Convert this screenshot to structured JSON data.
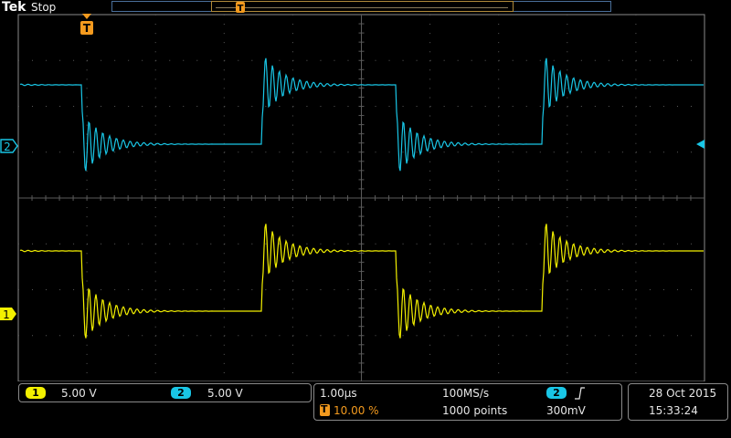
{
  "header": {
    "brand": "Tek",
    "run_state": "Stop"
  },
  "trigger": {
    "marker": "T",
    "position_percent": 10.0,
    "level_label": "10.00 %"
  },
  "channels": [
    {
      "id": "1",
      "color": "#f3f000",
      "scale": "5.00 V"
    },
    {
      "id": "2",
      "color": "#19c6e6",
      "scale": "5.00 V"
    }
  ],
  "timebase": {
    "scale": "1.00µs",
    "sample_rate": "100MS/s",
    "record_length": "1000 points",
    "trigger_source": "2",
    "trigger_slope_icon": "rising-edge-icon",
    "trigger_level": "300mV"
  },
  "datetime": {
    "date": "28 Oct  2015",
    "time": "15:33:24"
  },
  "colors": {
    "grid": "#5a5a5a",
    "trigger": "#f39a1e",
    "frame": "#8a8a8a"
  }
}
